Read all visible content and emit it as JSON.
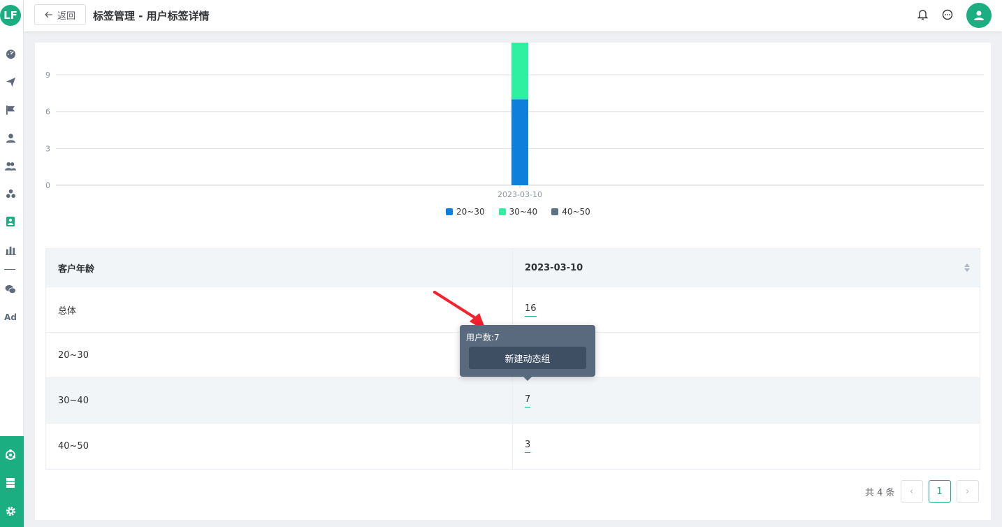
{
  "header": {
    "back_label": "返回",
    "title": "标签管理 - 用户标签详情"
  },
  "sidebar": {
    "logo_text": "LF",
    "ad_label": "Ad"
  },
  "colors": {
    "accent": "#1aae80",
    "series_20_30": "#0f7fdc",
    "series_30_40": "#2ef0a0",
    "series_40_50": "#5b7386"
  },
  "chart_data": {
    "type": "bar",
    "stacked": true,
    "categories": [
      "2023-03-10"
    ],
    "series": [
      {
        "name": "20~30",
        "values": [
          7
        ]
      },
      {
        "name": "30~40",
        "values": [
          7
        ]
      },
      {
        "name": "40~50",
        "values": [
          3
        ]
      }
    ],
    "yticks": [
      "0",
      "3",
      "6",
      "9"
    ],
    "ylim": [
      0,
      12
    ],
    "grid": true,
    "legend_position": "bottom"
  },
  "table": {
    "headers": [
      "客户年龄",
      "2023-03-10"
    ],
    "rows": [
      {
        "label": "总体",
        "value": "16"
      },
      {
        "label": "20~30",
        "value": "7"
      },
      {
        "label": "30~40",
        "value": "7"
      },
      {
        "label": "40~50",
        "value": "3"
      }
    ]
  },
  "tooltip": {
    "text": "用户数:7",
    "button_label": "新建动态组"
  },
  "pagination": {
    "total_label": "共 4 条",
    "current_page": "1",
    "prev_icon": "‹",
    "next_icon": "›"
  }
}
